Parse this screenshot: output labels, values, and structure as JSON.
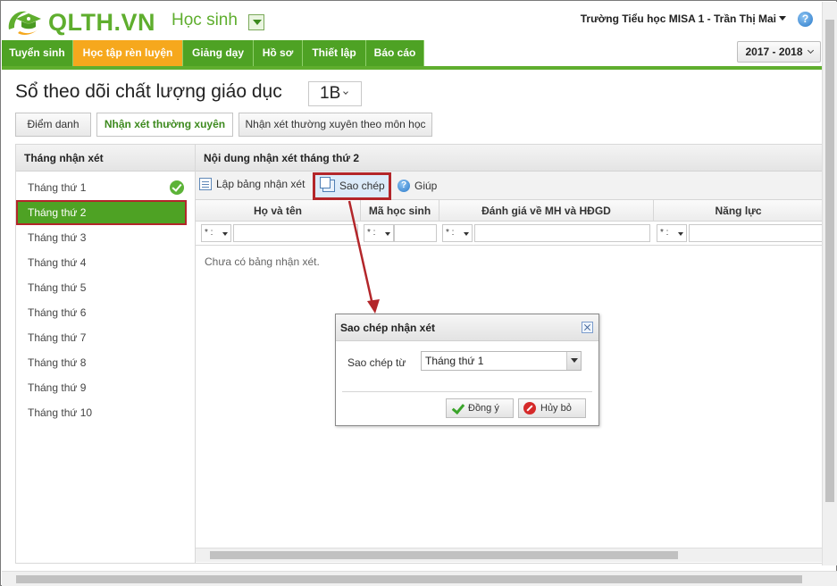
{
  "header": {
    "logo_text": "QLTH.VN",
    "role": "Học sinh",
    "school_user": "Trường Tiểu học MISA 1 - Trần Thị Mai",
    "help": "?",
    "icons": [
      "graduation-cap-logo-icon",
      "chevron-down-icon",
      "help-icon"
    ]
  },
  "nav": {
    "items": [
      "Tuyển sinh",
      "Học tập rèn luyện",
      "Giảng dạy",
      "Hồ sơ",
      "Thiết lập",
      "Báo cáo"
    ],
    "active_index": 1,
    "year": "2017 - 2018"
  },
  "page": {
    "title": "Sổ theo dõi chất lượng giáo dục",
    "class": "1B",
    "tabs": [
      "Điểm danh",
      "Nhận xét thường xuyên",
      "Nhận xét thường xuyên theo môn học"
    ],
    "active_tab": 1
  },
  "left_panel": {
    "header": "Tháng nhận xét",
    "months": [
      "Tháng thứ 1",
      "Tháng thứ 2",
      "Tháng thứ 3",
      "Tháng thứ 4",
      "Tháng thứ 5",
      "Tháng thứ 6",
      "Tháng thứ 7",
      "Tháng thứ 8",
      "Tháng thứ 9",
      "Tháng thứ 10"
    ],
    "selected_index": 1,
    "completed_index": 0
  },
  "main_panel": {
    "header": "Nội dung nhận xét tháng thứ 2",
    "toolbar": {
      "create": "Lập bảng nhận xét",
      "copy": "Sao chép",
      "help": "Giúp"
    },
    "columns": [
      "Họ và tên",
      "Mã học sinh",
      "Đánh giá về MH và HĐGD",
      "Năng lực"
    ],
    "filter_op": "* :",
    "empty_message": "Chưa có bảng nhận xét."
  },
  "dialog": {
    "title": "Sao chép nhận xét",
    "label": "Sao chép từ",
    "selected": "Tháng thứ 1",
    "ok": "Đồng ý",
    "cancel": "Hủy bỏ"
  },
  "colors": {
    "brand_green": "#4ea224",
    "active_orange": "#f6a81d",
    "highlight_red": "#b3262a"
  }
}
